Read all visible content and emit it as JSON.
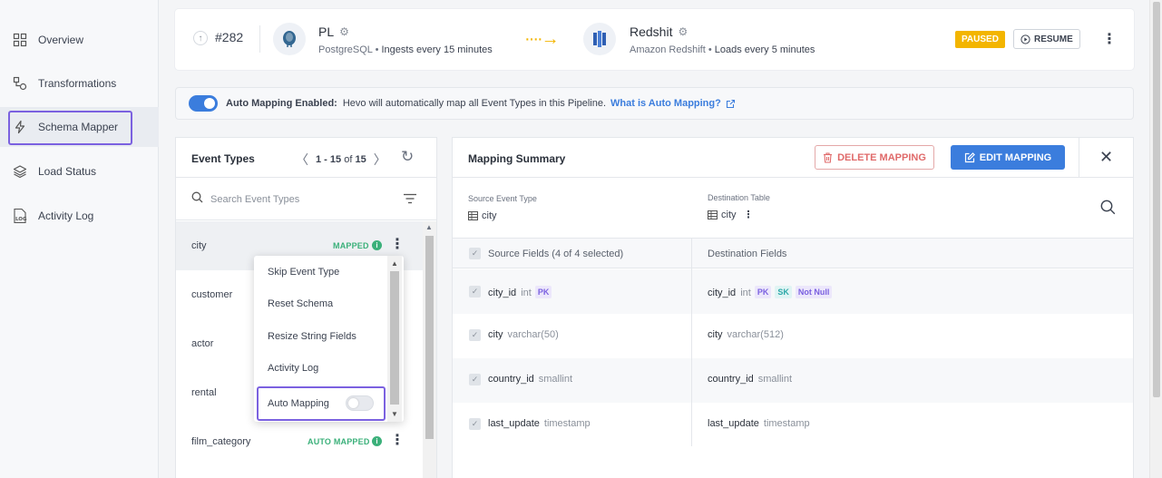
{
  "sidebar": {
    "items": [
      {
        "label": "Overview",
        "icon": "grid-icon"
      },
      {
        "label": "Transformations",
        "icon": "transform-icon"
      },
      {
        "label": "Schema Mapper",
        "icon": "lightning-icon"
      },
      {
        "label": "Load Status",
        "icon": "layers-icon"
      },
      {
        "label": "Activity Log",
        "icon": "log-icon"
      }
    ]
  },
  "pipeline": {
    "id": "#282",
    "source": {
      "name": "PL",
      "type": "PostgreSQL",
      "schedule": "Ingests every 15 minutes"
    },
    "destination": {
      "name": "Redshit",
      "type": "Amazon Redshift",
      "schedule": "Loads every 5 minutes"
    },
    "status": "PAUSED",
    "resume_label": "RESUME",
    "arrow": "····→",
    "status_color": "#f3b500"
  },
  "banner": {
    "title": "Auto Mapping Enabled:",
    "text": "Hevo will automatically map all Event Types in this Pipeline.",
    "link": "What is Auto Mapping?"
  },
  "events": {
    "title": "Event Types",
    "pager": {
      "range": "1 - 15",
      "of": "of",
      "total": "15"
    },
    "search_placeholder": "Search Event Types",
    "rows": [
      {
        "name": "city",
        "tag": "MAPPED"
      },
      {
        "name": "customer",
        "tag": ""
      },
      {
        "name": "actor",
        "tag": ""
      },
      {
        "name": "rental",
        "tag": ""
      },
      {
        "name": "film_category",
        "tag": "AUTO MAPPED"
      }
    ]
  },
  "context_menu": {
    "items": [
      "Skip Event Type",
      "Reset Schema",
      "Resize String Fields",
      "Activity Log",
      "Auto Mapping"
    ]
  },
  "mapping": {
    "title": "Mapping Summary",
    "delete_label": "DELETE MAPPING",
    "edit_label": "EDIT MAPPING",
    "source_label": "Source Event Type",
    "source_value": "city",
    "dest_label": "Destination Table",
    "dest_value": "city",
    "source_fields_header": "Source Fields (4 of 4 selected)",
    "dest_fields_header": "Destination Fields",
    "fields": [
      {
        "src": "city_id",
        "src_type": "int",
        "src_tags": [
          "PK"
        ],
        "dst": "city_id",
        "dst_type": "int",
        "dst_tags": [
          "PK",
          "SK",
          "Not Null"
        ]
      },
      {
        "src": "city",
        "src_type": "varchar(50)",
        "src_tags": [],
        "dst": "city",
        "dst_type": "varchar(512)",
        "dst_tags": []
      },
      {
        "src": "country_id",
        "src_type": "smallint",
        "src_tags": [],
        "dst": "country_id",
        "dst_type": "smallint",
        "dst_tags": []
      },
      {
        "src": "last_update",
        "src_type": "timestamp",
        "src_tags": [],
        "dst": "last_update",
        "dst_type": "timestamp",
        "dst_tags": []
      }
    ]
  },
  "colors": {
    "accent": "#3b7ddd",
    "highlight": "#7b61e0",
    "success": "#3bb07a",
    "danger": "#e06a6a"
  }
}
